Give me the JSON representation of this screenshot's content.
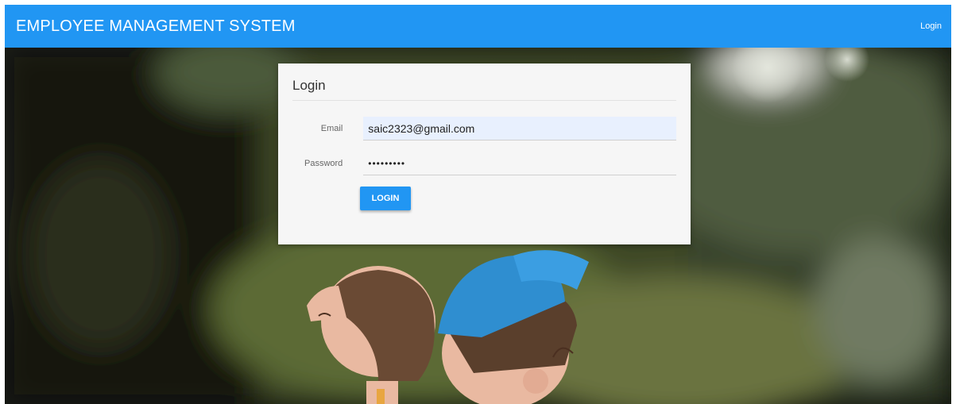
{
  "navbar": {
    "brand": "EMPLOYEE MANAGEMENT SYSTEM",
    "login_link": "Login",
    "color": "#2196f3"
  },
  "form": {
    "title": "Login",
    "email_label": "Email",
    "email_value": "saic2323@gmail.com",
    "password_label": "Password",
    "password_value": "•••••••••",
    "submit_label": "LOGIN"
  },
  "background": {
    "image": "blurred-bokeh-photo-two-figurines"
  }
}
